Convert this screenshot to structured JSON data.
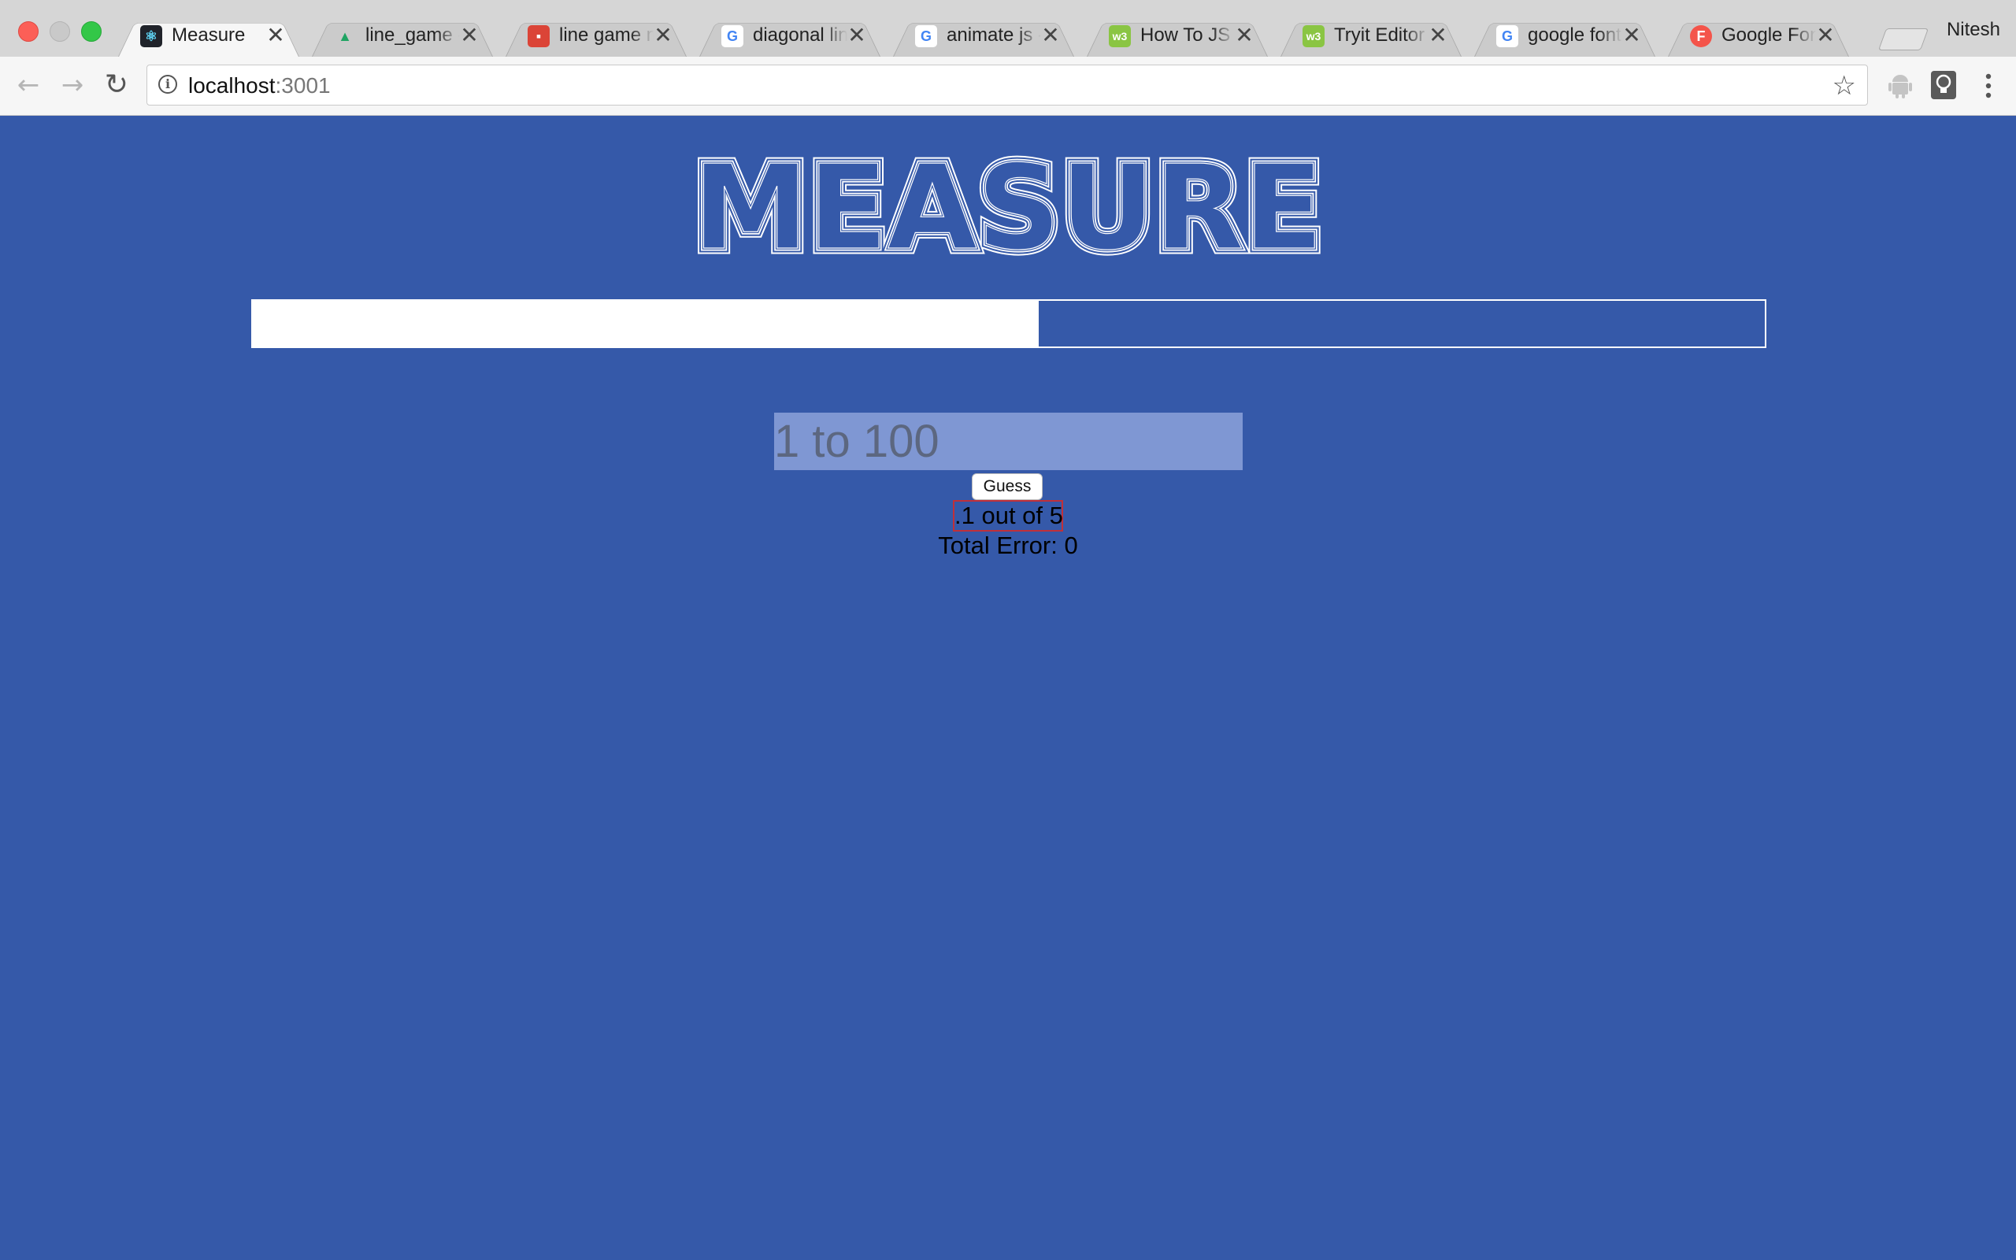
{
  "browser": {
    "tabs": [
      {
        "title": "Measure",
        "icon": "react-icon",
        "active": true
      },
      {
        "title": "line_game -",
        "icon": "google-drive-icon",
        "active": false
      },
      {
        "title": "line game m",
        "icon": "slides-icon",
        "active": false
      },
      {
        "title": "diagonal line",
        "icon": "google-icon",
        "active": false
      },
      {
        "title": "animate js -",
        "icon": "google-icon",
        "active": false
      },
      {
        "title": "How To JS A",
        "icon": "w3schools-icon",
        "active": false
      },
      {
        "title": "Tryit Editor v",
        "icon": "w3schools-icon",
        "active": false
      },
      {
        "title": "google fonts",
        "icon": "google-icon",
        "active": false
      },
      {
        "title": "Google Font",
        "icon": "fontawesome-icon",
        "active": false
      }
    ],
    "tab_close_glyph": "✕",
    "profile_name": "Nitesh",
    "url_host": "localhost",
    "url_port": ":3001"
  },
  "app": {
    "logo_text": "MEASURE",
    "progress_fraction": 0.52,
    "input": {
      "placeholder": "1 to 100",
      "value": ""
    },
    "guess_button_label": "Guess",
    "round_counter": ".1 out of 5",
    "total_error": "Total Error: 0"
  },
  "colors": {
    "page_background": "#3559a9",
    "input_background": "#7f97d3",
    "progress_fill": "#ffffff",
    "counter_border": "#c0303a"
  }
}
